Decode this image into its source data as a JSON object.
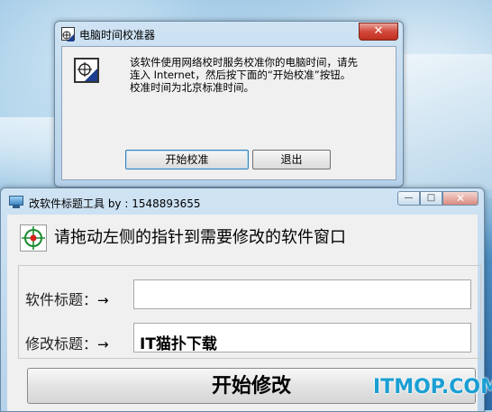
{
  "dialog": {
    "title": "电脑时间校准器",
    "message": "该软件使用网络校时服务校准你的电脑时间，请先\n连入 Internet，然后按下面的“开始校准”按钮。\n校准时间为北京标准时间。",
    "calibrate_label": "开始校准",
    "exit_label": "退出",
    "close_glyph": "✕"
  },
  "tool": {
    "title": "改软件标题工具 by : 1548893655",
    "instruction": "请拖动左侧的指针到需要修改的软件窗口",
    "software_title_label": "软件标题：",
    "modify_title_label": "修改标题：",
    "arrow": "→",
    "software_title_value": "",
    "modify_title_value": "IT猫扑下载",
    "start_label": "开始修改",
    "min_glyph": "—",
    "max_glyph": "□",
    "close_glyph": "✕"
  },
  "watermark": "ITMOP.COM",
  "icons": [
    "app-icon",
    "crosshair-pointer-icon",
    "monitor-icon"
  ]
}
